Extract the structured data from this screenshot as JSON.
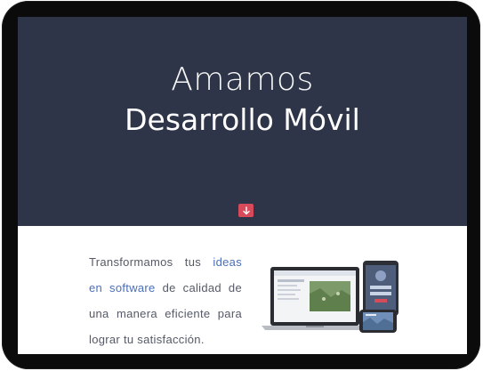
{
  "hero": {
    "line1": "Amamos",
    "line2": "Desarrollo Móvil",
    "scroll_icon": "arrow-down-icon",
    "accent_color": "#d64a5a",
    "background_color": "#2f3548"
  },
  "intro": {
    "part1": "Transformamos tus ",
    "highlight": "ideas en software",
    "part2": " de calidad de una manera eficiente para lograr tu satisfacción.",
    "highlight_color": "#4b6fb8"
  },
  "illustration": "devices-illustration"
}
